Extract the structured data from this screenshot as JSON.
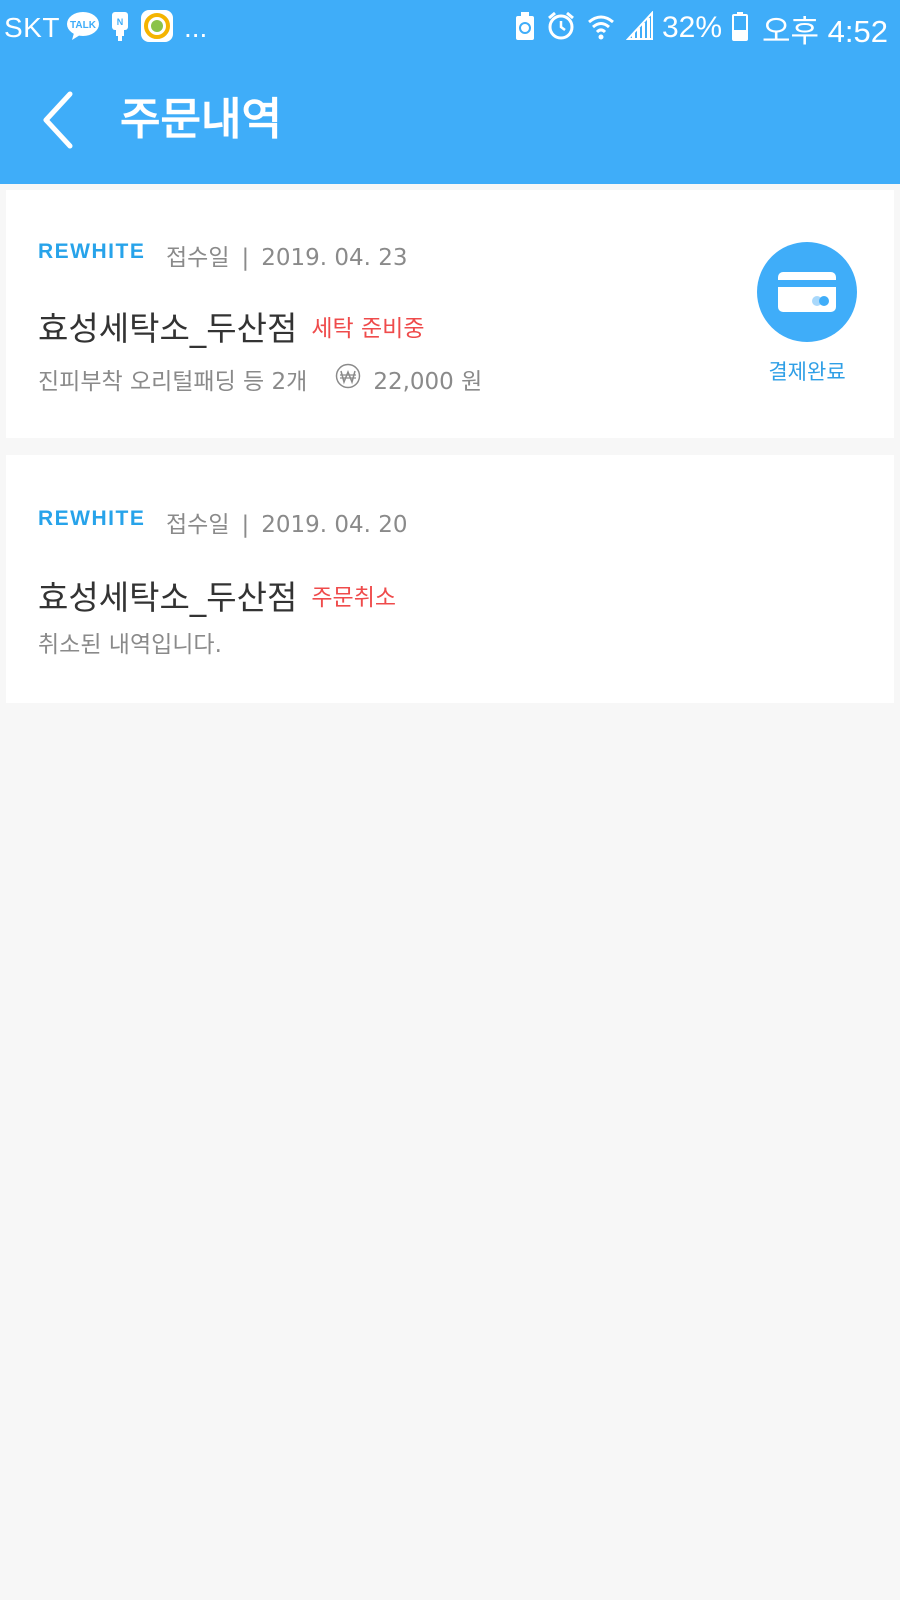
{
  "status_bar": {
    "carrier": "SKT",
    "more": "...",
    "battery": "32%",
    "time": "오후 4:52",
    "icons": [
      "kakaotalk-icon",
      "naver-icon",
      "app-icon",
      "battery-saver-icon",
      "alarm-icon",
      "wifi-icon",
      "signal-icon",
      "battery-icon"
    ],
    "talk_label": "TALK"
  },
  "header": {
    "title": "주문내역"
  },
  "orders": [
    {
      "brand": "REWHITE",
      "date_label": "접수일",
      "separator": "|",
      "date": "2019. 04. 23",
      "store": "효성세탁소_두산점",
      "status": "세탁 준비중",
      "description": "진피부착 오리털패딩 등 2개",
      "price": "22,000 원",
      "payment_status": "결제완료"
    },
    {
      "brand": "REWHITE",
      "date_label": "접수일",
      "separator": "|",
      "date": "2019. 04. 20",
      "store": "효성세탁소_두산점",
      "status": "주문취소",
      "description": "취소된 내역입니다."
    }
  ],
  "colors": {
    "primary": "#3fadf9",
    "status_red": "#ef4b4b",
    "brand_blue": "#27a3ea"
  }
}
